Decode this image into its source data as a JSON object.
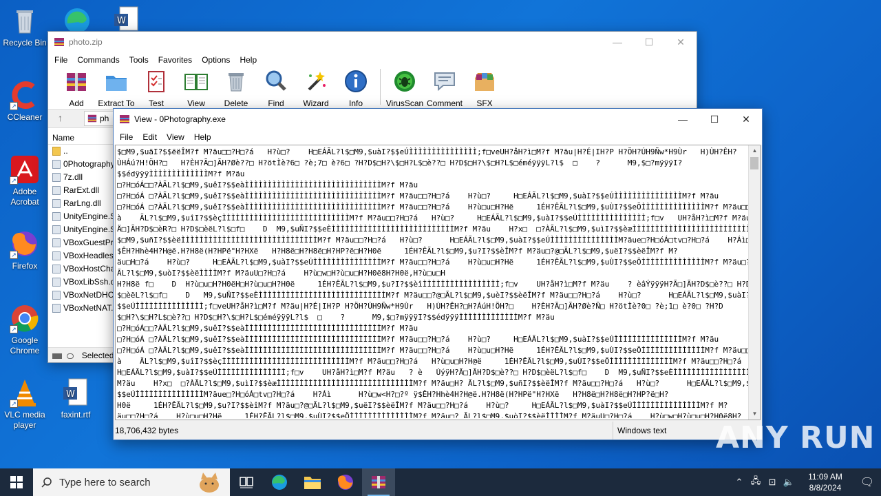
{
  "desktop": {
    "icons": [
      {
        "label": "Recycle Bin"
      },
      {
        "label": "CCleaner"
      },
      {
        "label": "Adobe Acrobat"
      },
      {
        "label": "Firefox"
      },
      {
        "label": "Google Chrome"
      },
      {
        "label": "VLC media player"
      },
      {
        "label": "faxint.rtf"
      }
    ]
  },
  "winrar": {
    "title": "photo.zip",
    "menu": [
      "File",
      "Commands",
      "Tools",
      "Favorites",
      "Options",
      "Help"
    ],
    "toolbar": [
      "Add",
      "Extract To",
      "Test",
      "View",
      "Delete",
      "Find",
      "Wizard",
      "Info",
      "VirusScan",
      "Comment",
      "SFX"
    ],
    "path_text": "ph",
    "list_header": "Name",
    "files": [
      "..",
      "0Photography",
      "7z.dll",
      "RarExt.dll",
      "RarLng.dll",
      "UnityEngine.S",
      "UnityEngine.S",
      "VBoxGuestPr",
      "VBoxHeadles",
      "VBoxHostCha",
      "VBoxLibSsh.d",
      "VBoxNetDHC",
      "VBoxNetNAT."
    ],
    "status": "Selected"
  },
  "viewer": {
    "title": "View - 0Photography.exe",
    "menu": [
      "File",
      "Edit",
      "View",
      "Help"
    ],
    "content": "$□M9,$uãI?$$ëëÎM?f M?äu□□?H□?á   H?ù□?    H□EÁÃL?l$□M9,$uàI?$$eÚÌÌÌÌÌÌÌÌÌÌÌÌÌÌÌ;f□veUH?åH?ì□M?f M?äu|H?É|IH?P H?ÖH?ÚH9Ñw*H9Ùr   H)ÙH?ÊH?\nÙHÁú?H!ÖH?□   H?ÈH?Ã□]ÃH?Øè??□ H?ötÌè?6□ ?è;7□ è?6□ ?H?D$□H?\\$□H?L$□è??□ H?D$□H?\\$□H?L$□éméÿÿÿL?l$  □    ?      M9,$□?mÿÿÿI?\n$$édÿÿÿÌÌÌÌÌÌÌÌÌÌÌÌÌM?f M?äu\n□?H□óÁ□□?ÀÃL?l$□M9,$uêI?$$eàÌÌÌÌÌÌÌÌÌÌÌÌÌÌÌÌÌÌÌÌÌÌÌÌÌÌÌÌÌÌM?f M?äu\n□?H□óÁ □?ÀÃL?l$□M9,$uêI?$$eàÌÌÌÌÌÌÌÌÌÌÌÌÌÌÌÌÌÌÌÌÌÌÌÌÌÌÌÌÌÌM?f M?äu□□?H□?á    H?ù□?     H□EÁÃL?l$□M9,$uàI?$$eÚÌÌÌÌÌÌÌÌÌÌÌÌÌÌÌM?f M?äu\n□?H□óÁ □?ÀÃL?l$□M9,$uêI?$$eàÌÌÌÌÌÌÌÌÌÌÌÌÌÌÌÌÌÌÌÌÌÌÌÌÌÌÌÌÌÌM?f M?äu□□?H□?á    H?ù□u□H?Hë     1ÉH?ÊÃL?l$□M9,$uÙI?$$eÖÌÌÌÌÌÌÌÌÌÌÌÌÌÌM?f M?äu□□?@□?\nà    ÃL?l$□M9,$uîI?$$èçÌÌÌÌÌÌÌÌÌÌÌÌÌÌÌÌÌÌÌÌÌÌÌÌÌÌÌÌM?f M?äu□□?H□?á   H?ù□?     H□EÁÃL?l$□M9,$uàI?$$eÚÌÌÌÌÌÌÌÌÌÌÌÌÌÌÌ;f□v   UH?åH?ì□M?f M?äu    ? èBáÿÿH?\nÄ□]ÃH?D$□èR?□ H?D$□èëL?l$□f□    D  M9,$uÑI?$$eÈÌÌÌÌÌÌÌÌÌÌÌÌÌÌÌÌÌÌÌÌÌÌÌÌÌÌÌM?f M?äu    H?x□  □?ÀÃL?l$□M9,$uìI?$$èæÌÌÌÌÌÌÌÌÌÌÌÌÌÌÌÌÌÌÌÌÌÌÌÌÌÌÌÌÌÌM?f M?äu□H? ÃL?l\n$□M9,$uñI?$$èëÌÌÌÌÌÌÌÌÌÌÌÌÌÌÌÌÌÌÌÌÌÌÌÌÌÌÌÌÌÌM?f M?äu□□?H□?á   H?ù□?      H□EÁÃL?l$□M9,$uàI?$$eÚÌÌÌÌÌÌÌÌÌÌÌÌÌÌÌM?äue□?H□óÁ□tv□?H□?á    H?Áì□      H?ù□w<H?□s?º ÿ\n$ÊH?Hhè4H?H@ë.H?H8ë(H?HPë\"H?HXë   H?H8ë□H?H8ë□H?HP?ë□H?H0ë     1ÉH?ÊÃL?l$□M9,$u?I?$$èÎM?f M?äu□?@□ÃL?l$□M9,$uëI?$$èëÎM?f M?\näu□H□?á    H?ù□?     H□EÁÃL?l$□M9,$uàI?$$eÚÌÌÌÌÌÌÌÌÌÌÌÌÌÌÌM?f M?äu□□?H□?á    H?ù□u□H?Hë     1ÉH?ÊÃL?l$□M9,$uÙI?$$eÖÌÌÌÌÌÌÌÌÌÌÌÌÌÌM?f M?äu□?\nÃL?l$□M9,$uòI?$$èëÌÌÌÌM?f M?äuU□?H□?á    H?ù□w□H?ù□u□H?H0ë8H?H0ë,H?ù□u□H\nH?H8ë f□    D  H?ù□u□H?H0ëH□H?ù□u□H?H0ë     1ÉH?ÊÃL?l$□M9,$u?I?$$èîÌÌÌÌÌÌÌÌÌÌÌÌÌÌÌÌÌ;f□v    UH?åH?ì□M?f M?äu    ? èâÝÿÿÿH?Ã□]ÃH?D$□è??□ H?D\n$□èëL?l$□f□    D   M9,$uÑI?$$eÈÌÌÌÌÌÌÌÌÌÌÌÌÌÌÌÌÌÌÌÌÌÌÌÌÌÌÌÌM?f M?äu□□?@□ÃL?l$□M9,$uèI?$$èëÎM?f M?äu□□?H□?á    H?ù□?      H□EÁÃL?l$□M9,$uàI?\n$$eÚÌÌÌÌÌÌÌÌÌÌÌÌÌÌÌ;f□veUH?åH?ì□M?f M?äu|H?É|IH?P H?ÖH?ÚH9Ñw*H9Ùr   H)ÙH?ÊH?□H?ÁúH!ÖH?□    H?ÈH?Ã□]ÃH?Øè?Ñ□ H?ötÌè?0□ ?è;1□ è?0□ ?H?D\n$□H?\\$□H?L$□è??□ H?D$□H?\\$□H?L$□éméÿÿÿL?l$  □    ?      M9,$□?mÿÿÿI?$$édÿÿÿÌÌÌÌÌÌÌÌÌÌÌÌÌM?f M?äu\n□?H□óÁ□□?ÀÃL?l$□M9,$uêI?$$eàÌÌÌÌÌÌÌÌÌÌÌÌÌÌÌÌÌÌÌÌÌÌÌÌÌÌÌÌÌÌM?f M?äu\n□?H□óÁ □?ÀÃL?l$□M9,$uêI?$$eàÌÌÌÌÌÌÌÌÌÌÌÌÌÌÌÌÌÌÌÌÌÌÌÌÌÌÌÌÌÌM?f M?äu□□?H□?á    H?ù□?     H□EÁÃL?l$□M9,$uàI?$$eÚÌÌÌÌÌÌÌÌÌÌÌÌÌÌÌM?f M?äu\n□?H□óÁ □?ÀÃL?l$□M9,$uêI?$$eàÌÌÌÌÌÌÌÌÌÌÌÌÌÌÌÌÌÌÌÌÌÌÌÌÌÌÌÌÌÌM?f M?äu□□?H□?á    H?ù□u□H?Hë     1ÉH?ÊÃL?l$□M9,$uÙI?$$eÖÌÌÌÌÌÌÌÌÌÌÌÌÌÌM?f M?äu□□?@□?\nà    ÃL?l$□M9,$uîI?$$èçÌÌÌÌÌÌÌÌÌÌÌÌÌÌÌÌÌÌÌÌÌÌÌÌÌÌÌÌM?f M?äu□□?H□?á   H?ù□u□H?H@ë     1ÉH?ÊÃL?l$□M9,$uÙI?$$eÖÌÌÌÌÌÌÌÌÌÌÌÌÌÌM?f M?äu□□?H□?á    H?ù□?\nH□EÁÃL?l$□M9,$uàI?$$eÚÌÌÌÌÌÌÌÌÌÌÌÌÌÌÌ;f□v    UH?åH?ì□M?f M?äu   ? è   ÚýÿH?Ã□]ÃH?D$□è??□ H?D$□èëL?l$□f□    D  M9,$uÑI?$$eÈÌÌÌÌÌÌÌÌÌÌÌÌÌÌÌÌÌÌÌÌÌÌÌÌÌÌÌM?f\nM?äu    H?x□  □?ÀÃL?l$□M9,$uìI?$$èæÌÌÌÌÌÌÌÌÌÌÌÌÌÌÌÌÌÌÌÌÌÌÌÌÌÌÌÌÌÌM?f M?äu□H? ÃL?l$□M9,$uñI?$$èëÎM?f M?äu□□?H□?á   H?ù□?      H□EÁÃL?l$□M9,$uàI?\n$$eÚÌÌÌÌÌÌÌÌÌÌÌÌÌÌÌM?äue□?H□óÁ□tv□?H□?á    H?Áì      H?ù□w<H?□?º ÿ$ÊH?Hhè4H?H@ë.H?H8ë(H?HPë\"H?HXë   H?H8ë□H?H8ë□H?HP?ë□H?\nH0ë     1ÉH?ÊÃL?l$□M9,$u?I?$$èîM?f M?äu□?@□ÃL?l$□M9,$uëI?$$èëÎM?f M?äu□□?H□?á    H?ù□?     H□EÁÃL?l$□M9,$uàI?$$eÚÌÌÌÌÌÌÌÌÌÌÌÌÌÌÌM?f M?\näu□□?H□?á    H?ù□u□H?Hë     1ÉH?ÊÃL?l$□M9,$uÙI?$$eÖÌÌÌÌÌÌÌÌÌÌÌÌÌÌM?f M?äu□? ÃL?l$□M9,$uòI?$$èëÌÌÌÌM?f M?äuU□?H□?á    H?ù□w□H?ù□u□H?H0ë8H?",
    "status_size": "18,706,432 bytes",
    "status_encoding": "Windows text"
  },
  "taskbar": {
    "search_placeholder": "Type here to search",
    "time": "11:09 AM",
    "date": "8/8/2024"
  },
  "watermark": "ANY RUN"
}
